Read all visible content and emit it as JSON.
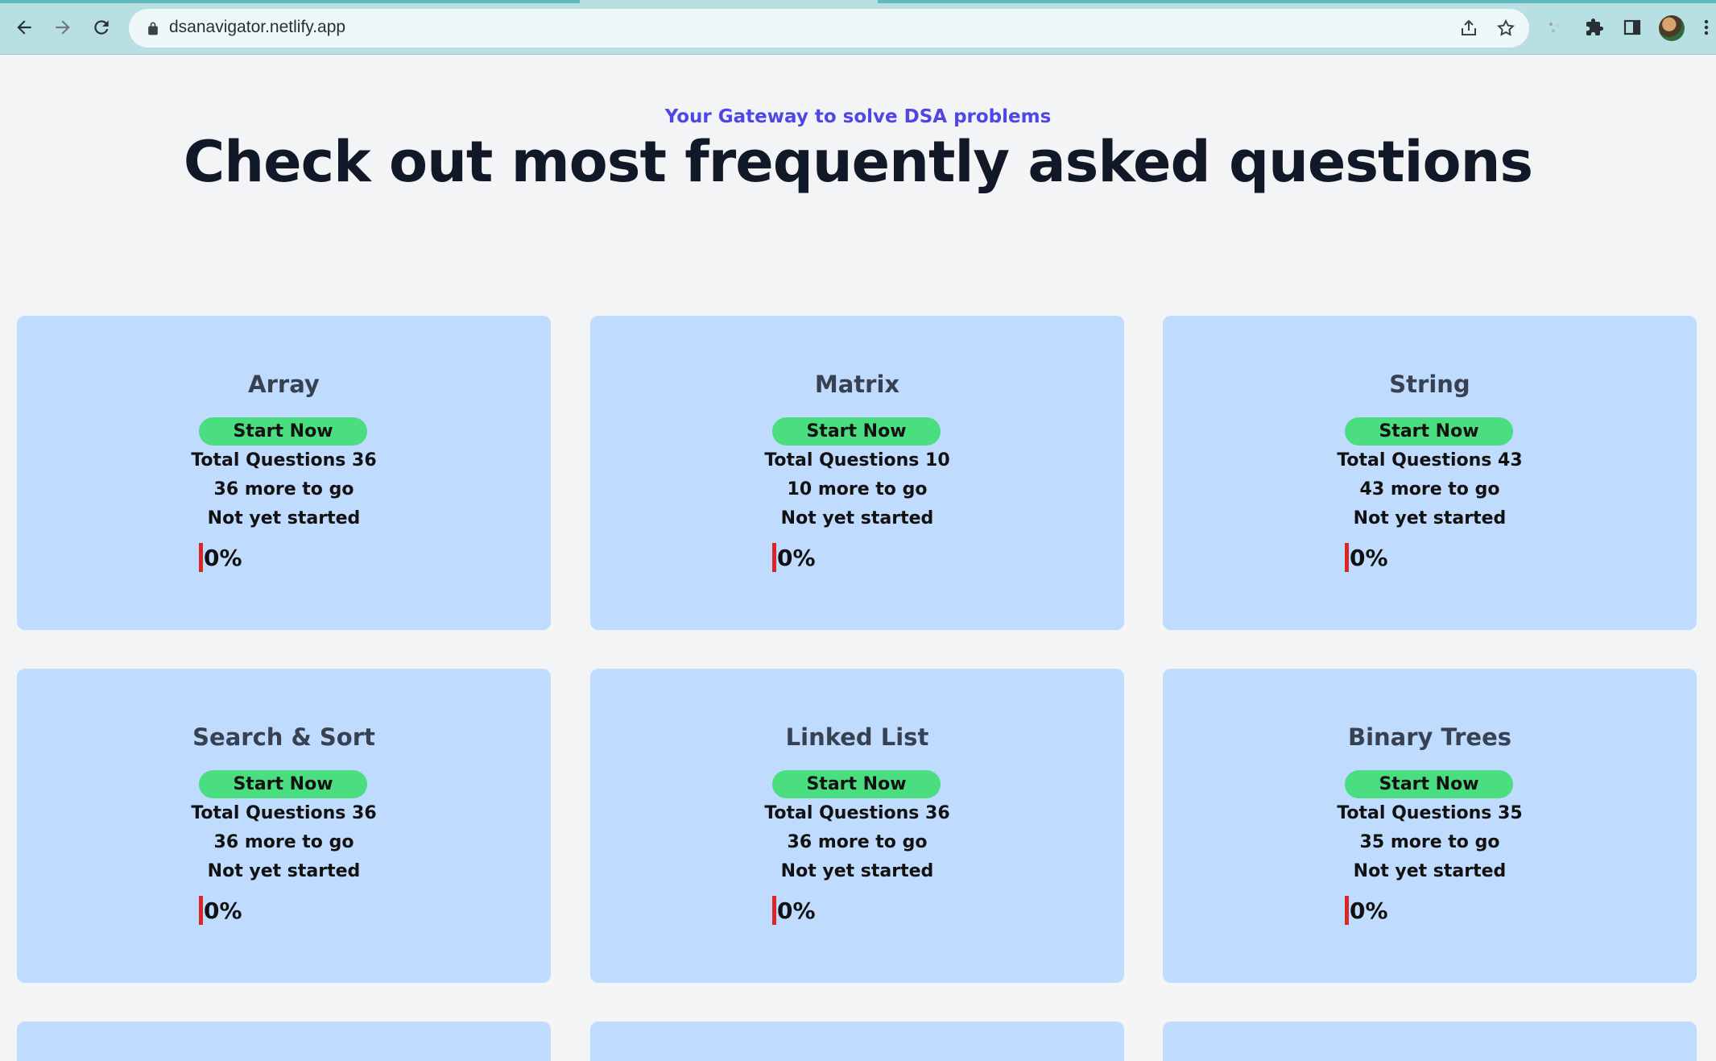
{
  "browser": {
    "url": "dsanavigator.netlify.app"
  },
  "hero": {
    "subtitle": "Your Gateway to solve DSA problems",
    "title": "Check out most frequently asked questions"
  },
  "cards": [
    {
      "title": "Array",
      "button": "Start Now",
      "total": "Total Questions 36",
      "remaining": "36 more to go",
      "status": "Not yet started",
      "progress": "0%"
    },
    {
      "title": "Matrix",
      "button": "Start Now",
      "total": "Total Questions 10",
      "remaining": "10 more to go",
      "status": "Not yet started",
      "progress": "0%"
    },
    {
      "title": "String",
      "button": "Start Now",
      "total": "Total Questions 43",
      "remaining": "43 more to go",
      "status": "Not yet started",
      "progress": "0%"
    },
    {
      "title": "Search & Sort",
      "button": "Start Now",
      "total": "Total Questions 36",
      "remaining": "36 more to go",
      "status": "Not yet started",
      "progress": "0%"
    },
    {
      "title": "Linked List",
      "button": "Start Now",
      "total": "Total Questions 36",
      "remaining": "36 more to go",
      "status": "Not yet started",
      "progress": "0%"
    },
    {
      "title": "Binary Trees",
      "button": "Start Now",
      "total": "Total Questions 35",
      "remaining": "35 more to go",
      "status": "Not yet started",
      "progress": "0%"
    }
  ],
  "colors": {
    "accent": "#4f46e5",
    "card_bg": "#bfdbfe",
    "button": "#4ade80",
    "progress_bar": "#dc2626"
  }
}
